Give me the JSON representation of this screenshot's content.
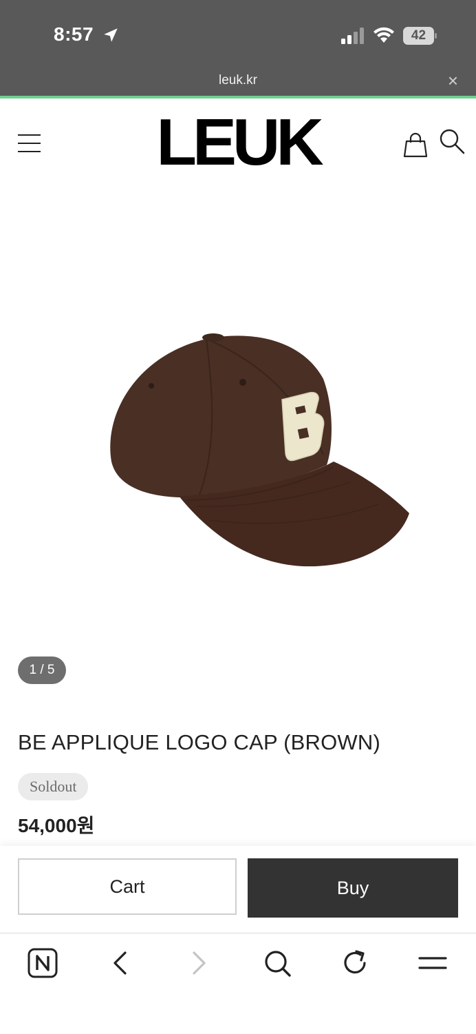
{
  "status_bar": {
    "time": "8:57",
    "battery": "42",
    "icons": [
      "location-arrow-icon",
      "signal-icon",
      "wifi-icon",
      "battery-icon"
    ]
  },
  "browser": {
    "url": "leuk.kr",
    "close_symbol": "×"
  },
  "header": {
    "brand": "LEUK",
    "icons": [
      "menu-icon",
      "shopping-bag-icon",
      "search-icon"
    ]
  },
  "product": {
    "image_counter": "1 / 5",
    "title": "BE APPLIQUE LOGO CAP (BROWN)",
    "status_badge": "Soldout",
    "price": "54,000원",
    "image_subject": "brown baseball cap with cream B appliqué"
  },
  "actions": {
    "cart_label": "Cart",
    "buy_label": "Buy"
  },
  "browser_toolbar": {
    "icons": [
      "naver-home-icon",
      "back-icon",
      "forward-icon",
      "search-icon",
      "refresh-icon",
      "menu-icon"
    ]
  },
  "colors": {
    "status_bg": "#595959",
    "load_line": "#6fd08f",
    "buy_bg": "#333333",
    "cap_brown": "#4a2f24",
    "applique_cream": "#ece6cc"
  }
}
